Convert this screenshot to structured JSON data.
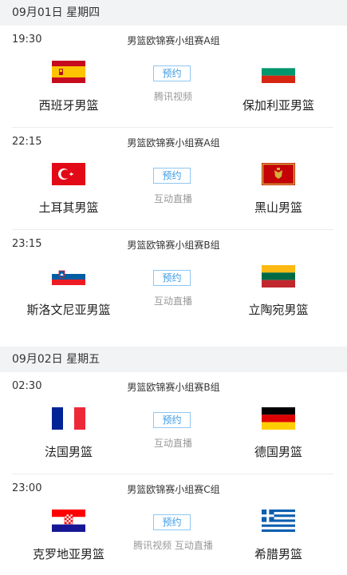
{
  "days": [
    {
      "date": "09月01日 星期四",
      "matches": [
        {
          "time": "19:30",
          "league": "男篮欧锦赛小组赛A组",
          "home": "西班牙男篮",
          "away": "保加利亚男篮",
          "home_flag": "spain-flag",
          "away_flag": "bulgaria-flag",
          "button": "预约",
          "channel": "腾讯视频"
        },
        {
          "time": "22:15",
          "league": "男篮欧锦赛小组赛A组",
          "home": "土耳其男篮",
          "away": "黑山男篮",
          "home_flag": "turkey-flag",
          "away_flag": "montenegro-flag",
          "button": "预约",
          "channel": "互动直播"
        },
        {
          "time": "23:15",
          "league": "男篮欧锦赛小组赛B组",
          "home": "斯洛文尼亚男篮",
          "away": "立陶宛男篮",
          "home_flag": "slovenia-flag",
          "away_flag": "lithuania-flag",
          "button": "预约",
          "channel": "互动直播"
        }
      ]
    },
    {
      "date": "09月02日 星期五",
      "matches": [
        {
          "time": "02:30",
          "league": "男篮欧锦赛小组赛B组",
          "home": "法国男篮",
          "away": "德国男篮",
          "home_flag": "france-flag",
          "away_flag": "germany-flag",
          "button": "预约",
          "channel": "互动直播"
        },
        {
          "time": "23:00",
          "league": "男篮欧锦赛小组赛C组",
          "home": "克罗地亚男篮",
          "away": "希腊男篮",
          "home_flag": "croatia-flag",
          "away_flag": "greece-flag",
          "button": "预约",
          "channel": "腾讯视频 互动直播"
        }
      ]
    }
  ],
  "colors": {
    "accent": "#3a9be6",
    "header_bg": "#f2f3f5",
    "muted": "#999999"
  }
}
